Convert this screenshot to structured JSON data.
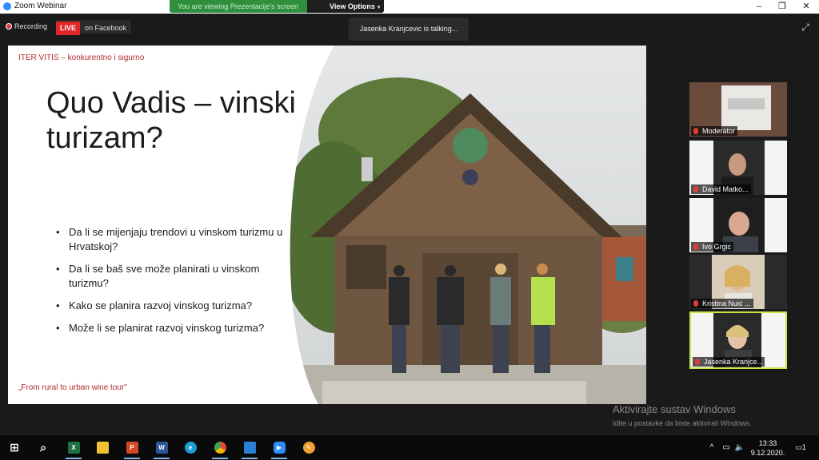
{
  "window": {
    "title": "Zoom Webinar",
    "controls": [
      "–",
      "❐",
      "✕"
    ]
  },
  "banner": {
    "viewing_text": "You are viewing Prezentacije's screen",
    "view_options_label": "View Options",
    "caret": "▾"
  },
  "toolbar": {
    "recording_label": "Recording",
    "live_badge": "LIVE",
    "live_target": "on Facebook",
    "talking_text": "Jasenka Kranjcevic is talking...",
    "expand_icon": "⤢"
  },
  "slide": {
    "org": "ITER VITIS – konkurentno i sigurno",
    "headline": "Quo Vadis – vinski turizam?",
    "bullets": [
      "Da li se mijenjaju trendovi u vinskom turizmu u Hrvatskoj?",
      "Da li se baš sve može planirati u vinskom turizmu?",
      "Kako se planira razvoj vinskog turizma?",
      "Može li se planirat razvoj vinskog turizma?"
    ],
    "footer": "„From rural to urban wine tour\""
  },
  "participants": [
    {
      "name": "Moderator",
      "active": false
    },
    {
      "name": "David Matko...",
      "active": false
    },
    {
      "name": "Ivo Grgic",
      "active": false
    },
    {
      "name": "Kristina Nuić ...",
      "active": false
    },
    {
      "name": "Jasenka Kranjce...",
      "active": true
    }
  ],
  "watermark": {
    "line1": "Aktivirajte sustav Windows",
    "line2": "Idite u postavke da biste aktivirali Windows."
  },
  "taskbar": {
    "apps": [
      {
        "name": "windows-start",
        "glyph": "⊞",
        "color": "#ffffff"
      },
      {
        "name": "search",
        "glyph": "⌕",
        "color": "#ffffff"
      },
      {
        "name": "excel",
        "glyph": "X",
        "color": "#1e7145"
      },
      {
        "name": "file-explorer",
        "glyph": "",
        "color": "#f2c231"
      },
      {
        "name": "powerpoint",
        "glyph": "P",
        "color": "#d24726"
      },
      {
        "name": "word",
        "glyph": "W",
        "color": "#2b579a"
      },
      {
        "name": "edge",
        "glyph": "e",
        "color": "#1f9bd6"
      },
      {
        "name": "chrome",
        "glyph": "",
        "color": "#e8453c"
      },
      {
        "name": "photos",
        "glyph": "",
        "color": "#2a7fd4"
      },
      {
        "name": "zoom",
        "glyph": "▶",
        "color": "#2d8cff"
      },
      {
        "name": "paint",
        "glyph": "✎",
        "color": "#f0a030"
      }
    ],
    "tray": {
      "chevron": "^",
      "network": "▭",
      "volume": "🔈"
    },
    "time": "13:33",
    "date": "9.12.2020.",
    "notifications": "1"
  }
}
